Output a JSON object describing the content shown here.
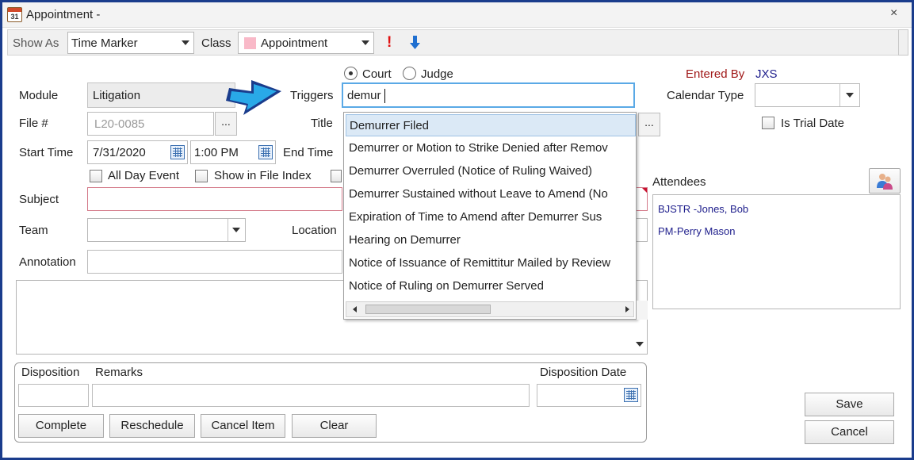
{
  "window": {
    "title": "Appointment -",
    "icon_text": "31",
    "close": "×"
  },
  "toolbar": {
    "show_as_label": "Show As",
    "show_as_value": "Time Marker",
    "class_label": "Class",
    "class_value": "Appointment",
    "priority_icon": "!",
    "down_icon": "down-arrow-icon"
  },
  "triggers_mode": {
    "court": "Court",
    "judge": "Judge",
    "selected": "Court"
  },
  "entered_by": {
    "label": "Entered By",
    "value": "JXS"
  },
  "form": {
    "module_label": "Module",
    "module_value": "Litigation",
    "file_label": "File #",
    "file_value": "L20-0085",
    "start_time_label": "Start Time",
    "start_date": "7/31/2020",
    "start_time": "1:00 PM",
    "end_time_label": "End Time",
    "all_day_label": "All Day Event",
    "show_in_index_label": "Show in File Index",
    "subject_label": "Subject",
    "team_label": "Team",
    "location_label": "Location",
    "annotation_label": "Annotation",
    "triggers_label": "Triggers",
    "triggers_value": "demur",
    "title_label": "Title",
    "calendar_type_label": "Calendar Type",
    "is_trial_label": "Is Trial Date",
    "dots": "..."
  },
  "dropdown": {
    "items": [
      "Demurrer Filed",
      "Demurrer or Motion to Strike Denied after Remov",
      "Demurrer Overruled (Notice of Ruling Waived)",
      "Demurrer Sustained without Leave to Amend (No",
      "Expiration of Time to Amend after Demurrer Sus",
      "Hearing on Demurrer",
      "Notice of Issuance of Remittitur Mailed by Review",
      "Notice of Ruling on Demurrer Served"
    ],
    "selected_index": 0
  },
  "attendees": {
    "label": "Attendees",
    "list": [
      "BJSTR  -Jones, Bob",
      "PM-Perry Mason"
    ]
  },
  "disposition": {
    "disposition_label": "Disposition",
    "remarks_label": "Remarks",
    "date_label": "Disposition Date"
  },
  "buttons": {
    "complete": "Complete",
    "reschedule": "Reschedule",
    "cancel_item": "Cancel Item",
    "clear": "Clear",
    "save": "Save",
    "cancel": "Cancel"
  },
  "colors": {
    "accent_red": "#a01818",
    "link_blue": "#1e1e8c",
    "arrow_blue": "#29a9e8",
    "frame_blue": "#1a3c8c"
  }
}
